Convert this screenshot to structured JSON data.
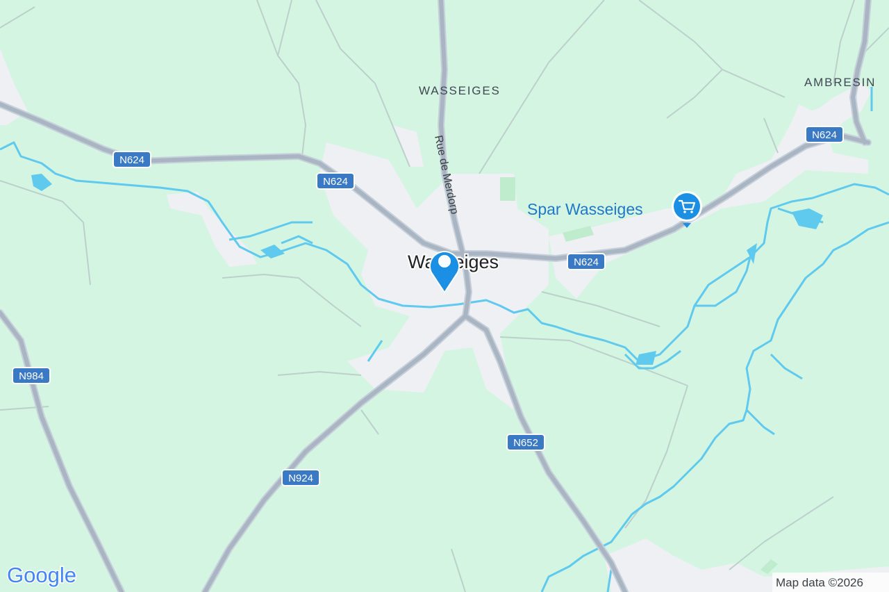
{
  "map": {
    "colors": {
      "land": "#d4f5e2",
      "urban": "#eef0f3",
      "road": "#a9b5c3",
      "road_casing": "#c7d0da",
      "minor_road": "#bfd2cb",
      "water": "#5fc9ee",
      "park": "#bfeccd",
      "shield": "#3a79c3",
      "marker": "#1a8fe3"
    },
    "places": {
      "wasseiges_area": "WASSEIGES",
      "ambresin": "AMBRESIN",
      "town": "Wasseiges"
    },
    "streets": {
      "rue_de_merdorp": "Rue de Merdorp"
    },
    "routes": {
      "n624_west": "N624",
      "n624_center": "N624",
      "n624_east": "N624",
      "n624_ne": "N624",
      "n984": "N984",
      "n924": "N924",
      "n652": "N652"
    },
    "poi": {
      "spar": {
        "label": "Spar Wasseiges",
        "icon": "shopping-cart-icon"
      }
    },
    "marker_icon": "location-pin-icon",
    "attribution": {
      "logo": "Google",
      "map_data": "Map data ©2026"
    }
  }
}
